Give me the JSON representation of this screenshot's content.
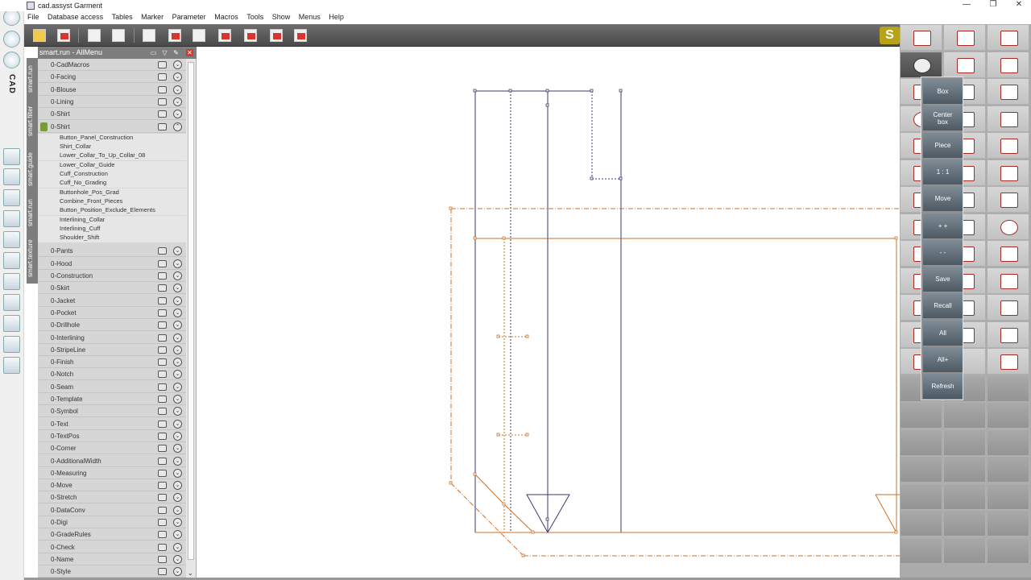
{
  "titlebar": {
    "title": "cad.assyst  Garment",
    "min": "—",
    "restore": "❐",
    "close": "✕"
  },
  "menubar": {
    "items": [
      "File",
      "Database access",
      "Tables",
      "Marker",
      "Parameter",
      "Macros",
      "Tools",
      "Show",
      "Menus",
      "Help"
    ]
  },
  "leftstrip": {
    "cad_label": "CAD"
  },
  "toolbar": {
    "smart_label": "S",
    "expand_label": "❯"
  },
  "vtabs": [
    "smart.run",
    "smart.filter",
    "smart.guide",
    "smart.run",
    "smart.texture"
  ],
  "panel": {
    "title": "smart.run - AllMenu",
    "scroll_down": "⌄",
    "rows_top": [
      "0-CadMacros",
      "0-Facing",
      "0-Blouse",
      "0-Lining",
      "0-Shirt",
      "0-Shirt"
    ],
    "shirt_items": [
      "Button_Panel_Construction",
      "Shirt_Collar",
      "Lower_Collar_To_Up_Collar_08",
      "Lower_Collar_Guide",
      "Cuff_Construction",
      "Cuff_No_Grading",
      "Buttonhole_Pos_Grad",
      "Combine_Front_Pieces",
      "Button_Position_Exclude_Elements",
      "Interlining_Collar",
      "Interlining_Cuff",
      "Shoulder_Shift"
    ],
    "rows_bottom": [
      "0-Pants",
      "0-Hood",
      "0-Construction",
      "0-Skirt",
      "0-Jacket",
      "0-Pocket",
      "0-Drillhole",
      "0-Interlining",
      "0-StripeLine",
      "0-Finish",
      "0-Notch",
      "0-Seam",
      "0-Template",
      "0-Symbol",
      "0-Text",
      "0-TextPos",
      "0-Corner",
      "0-AdditionalWidth",
      "0-Measuring",
      "0-Move",
      "0-Stretch",
      "0-DataConv",
      "0-Digi",
      "0-GradeRules",
      "0-Check",
      "0-Name",
      "0-Style"
    ]
  },
  "zoommenu": {
    "buttons": [
      "Box",
      "Center\nbox",
      "Piece",
      "1 : 1",
      "Move",
      "+ +",
      "- -",
      "Save",
      "Recall",
      "All",
      "All+",
      "Refresh"
    ]
  },
  "colors": {
    "toolbar_bg": "#5a5a5a",
    "accent_red": "#d9362a",
    "pattern_blue": "#3a3a6e",
    "pattern_orange": "#c8702a",
    "smart_gold": "#b8a21a"
  }
}
